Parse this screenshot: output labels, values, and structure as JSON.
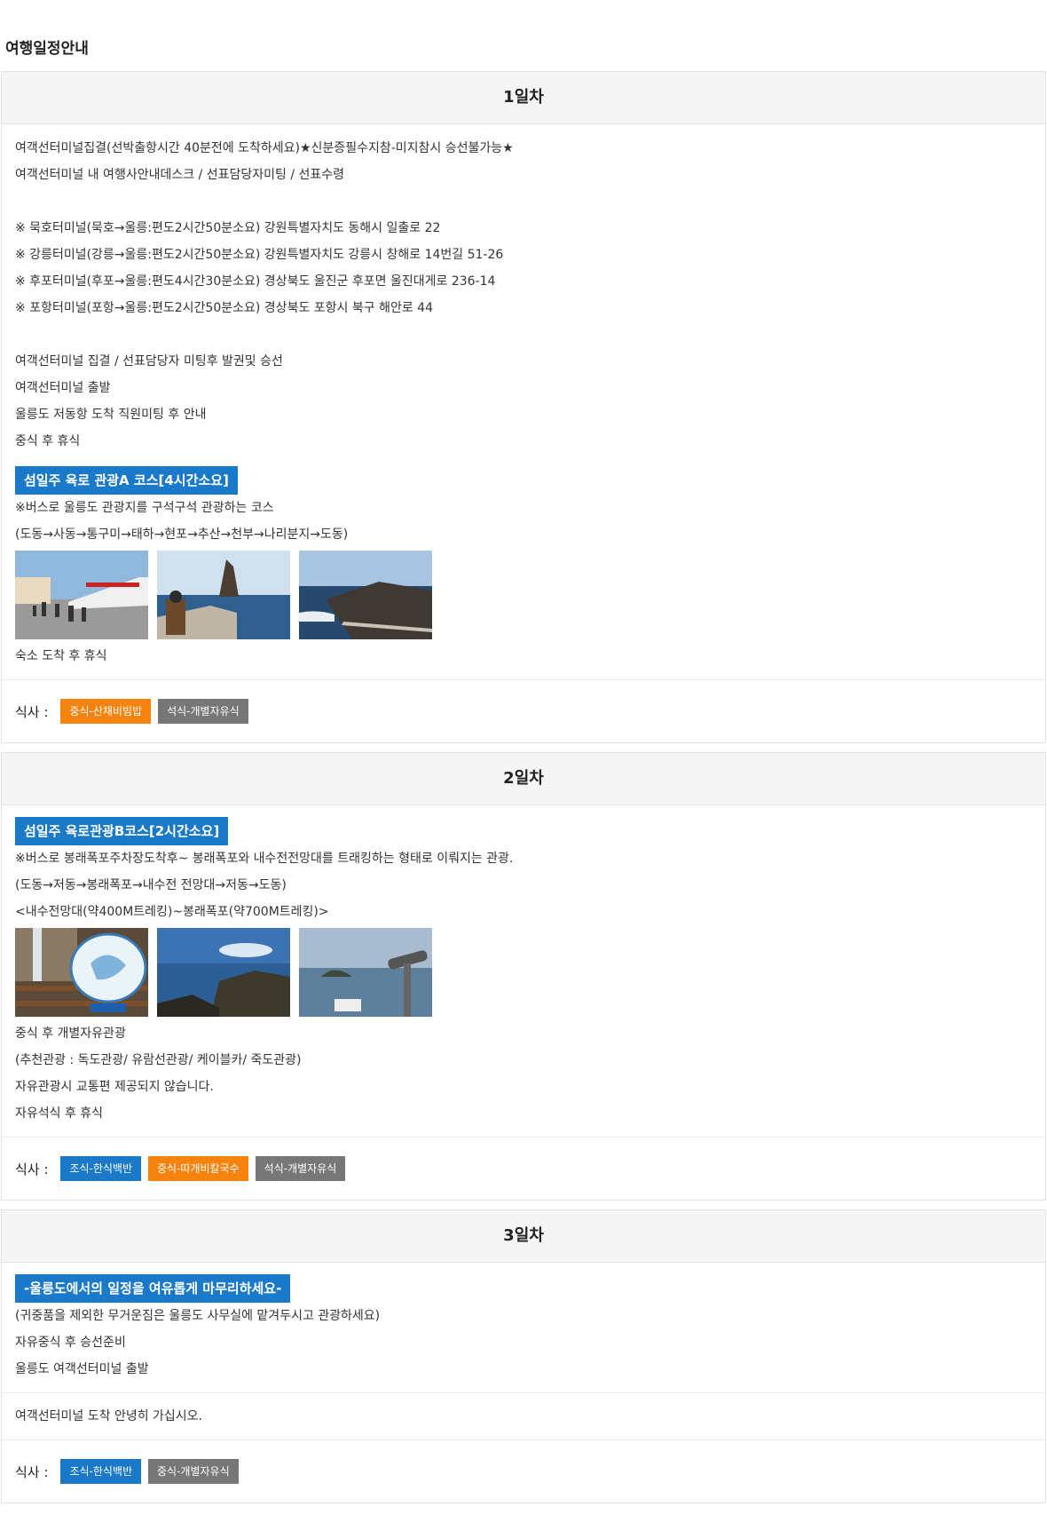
{
  "page_title": "여행일정안내",
  "days": [
    {
      "title": "1일차",
      "lines_top": [
        "여객선터미널집결(선박출항시간 40분전에 도착하세요)★신분증필수지참-미지참시 승선불가능★",
        "여객선터미널 내 여행사안내데스크 / 선표담당자미팅 / 선표수령"
      ],
      "terminals": [
        "※ 묵호터미널(묵호→울릉:편도2시간50분소요) 강원특별자치도 동해시 일출로 22",
        "※ 강릉터미널(강릉→울릉:편도2시간50분소요) 강원특별자치도 강릉시 창해로 14번길 51-26",
        "※ 후포터미널(후포→울릉:편도4시간30분소요) 경상북도 울진군 후포면 울진대게로 236-14",
        "※ 포항터미널(포항→울릉:편도2시간50분소요) 경상북도 포항시 북구 해안로 44"
      ],
      "lines_mid": [
        "여객선터미널 집결 / 선표담당자 미팅후 발권및 승선",
        "여객선터미널 출발",
        "울릉도 저동항 도착 직원미팅 후 안내",
        "중식 후 휴식"
      ],
      "course_badge": "섬일주 육로 관광A 코스[4시간소요]",
      "course_lines": [
        "※버스로 울릉도 관광지를 구석구석 관광하는 코스",
        "(도동→사동→통구미→태하→현포→추산→천부→나리분지→도동)"
      ],
      "after_photos": [
        "숙소 도착 후 휴식"
      ],
      "meal_label": "식사 :",
      "meals": [
        "중식-산채비빔밥",
        "석식-개별자유식"
      ]
    },
    {
      "title": "2일차",
      "course_badge": "섬일주 육로관광B코스[2시간소요]",
      "course_lines": [
        "※버스로 봉래폭포주차장도착후~ 봉래폭포와 내수전전망대를 트래킹하는 형태로 이뤄지는 관광.",
        "(도동→저동→봉래폭포→내수전 전망대→저동→도동)",
        "<내수전망대(약400M트레킹)~봉래폭포(약700M트레킹)>"
      ],
      "after_photos": [
        "중식 후 개별자유관광",
        "(추천관광 : 독도관광/ 유람선관광/ 케이블카/ 죽도관광)",
        "자유관광시 교통편 제공되지 않습니다.",
        "자유석식 후 휴식"
      ],
      "meal_label": "식사 :",
      "meals": [
        "조식-한식백반",
        "중식-따개비칼국수",
        "석식-개별자유식"
      ]
    },
    {
      "title": "3일차",
      "course_badge": "-울릉도에서의 일정을 여유롭게 마무리하세요-",
      "course_lines": [
        "(귀중품을 제외한 무거운짐은 울릉도 사무실에 맡겨두시고 관광하세요)",
        "자유중식 후 승선준비",
        "울릉도 여객선터미널 출발"
      ],
      "note": "여객선터미널 도착 안녕히 가십시오.",
      "meal_label": "식사 :",
      "meals": [
        "조식-한식백반",
        "중식-개별자유식"
      ]
    }
  ],
  "colors": {
    "badge_blue": "#1a7ac9",
    "chip_orange": "#f7830f",
    "chip_gray": "#777777"
  }
}
